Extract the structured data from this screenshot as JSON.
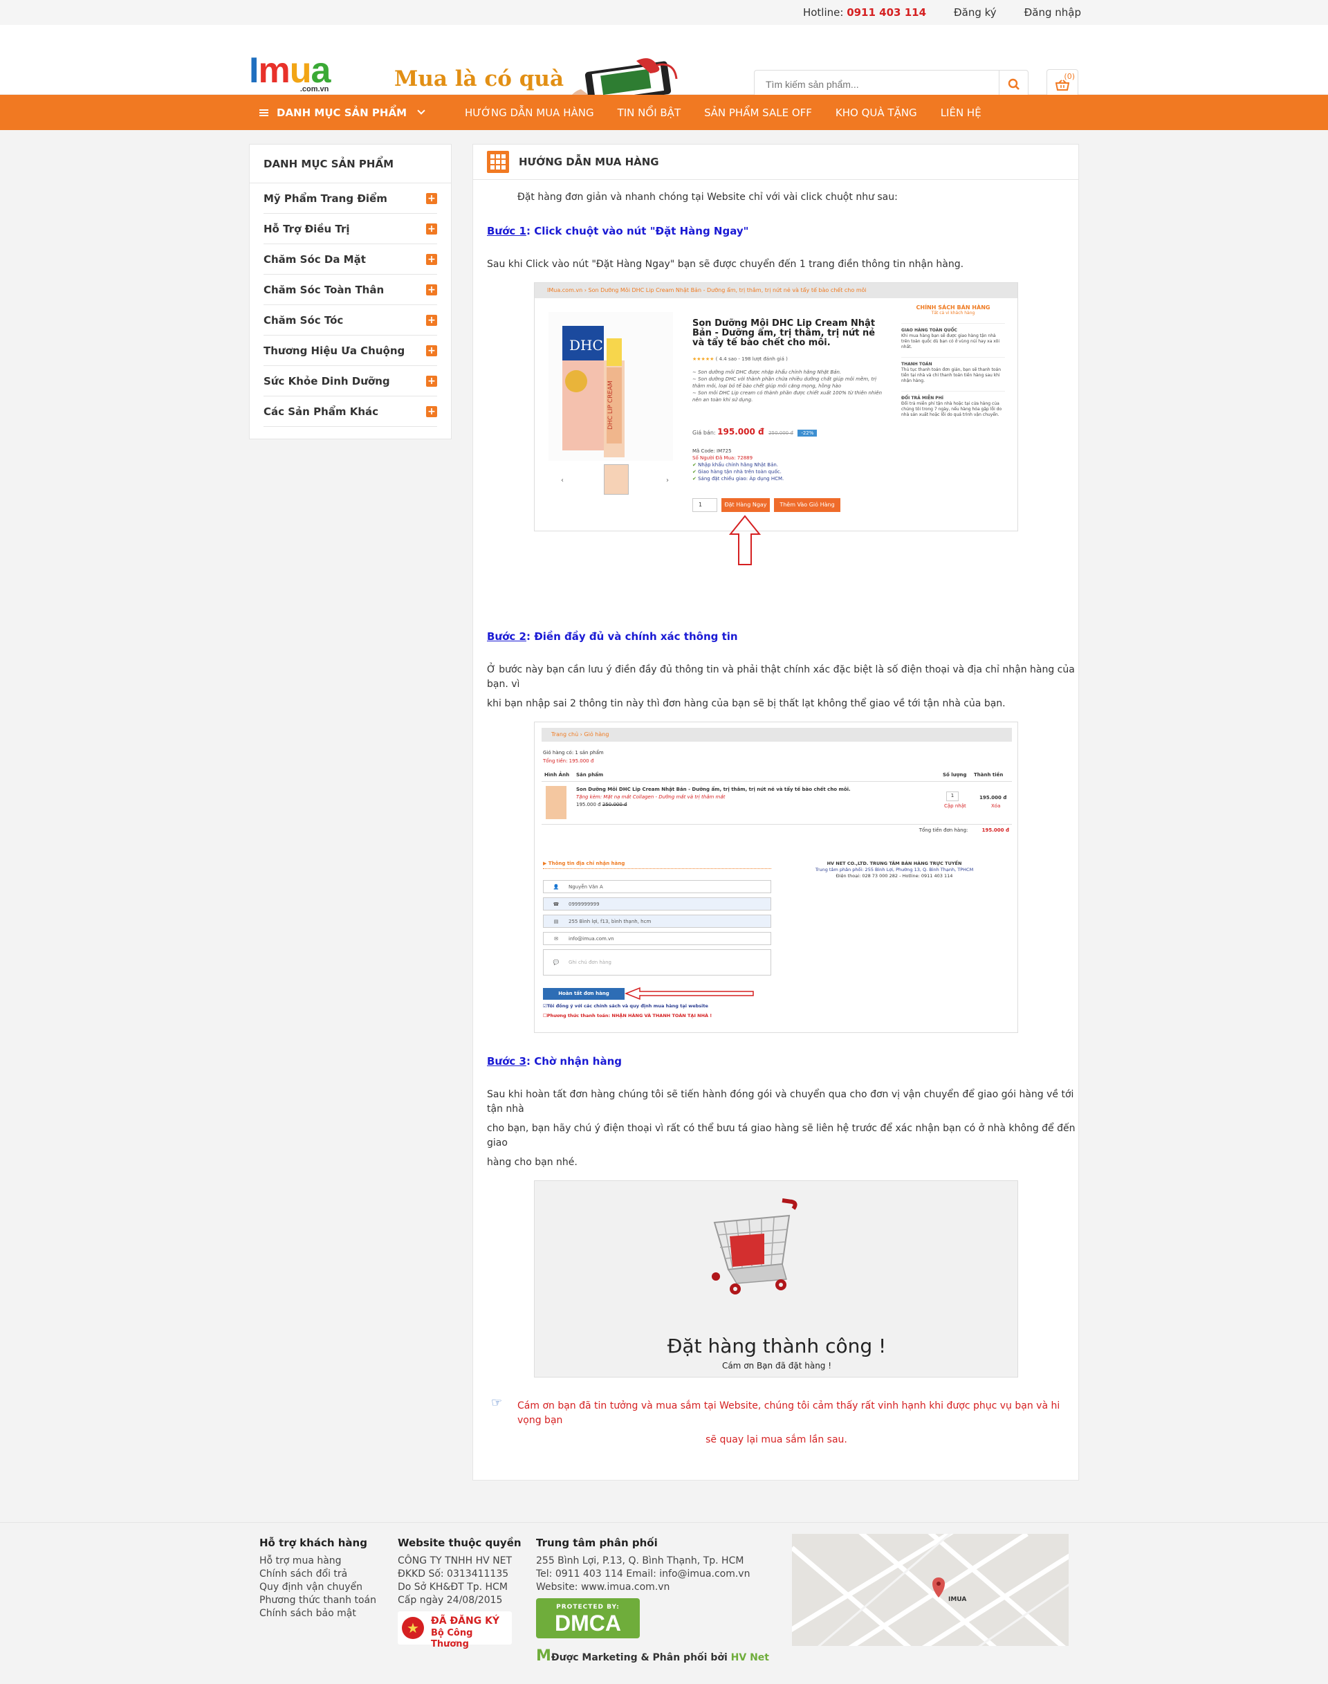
{
  "topbar": {
    "hotline_label": "Hotline:",
    "hotline_number": "0911 403 114",
    "register": "Đăng ký",
    "login": "Đăng nhập"
  },
  "header": {
    "logo": "IMUA",
    "logo_sub": ".com.vn",
    "banner_text": "Mua là có quà",
    "search_placeholder": "Tìm kiếm sản phẩm...",
    "cart_count": "(0)"
  },
  "nav": {
    "category_label": "DANH MỤC SẢN PHẨM",
    "items": [
      "HƯỚNG DẪN MUA HÀNG",
      "TIN NỔI BẬT",
      "SẢN PHẨM SALE OFF",
      "KHO QUÀ TẶNG",
      "LIÊN HỆ"
    ]
  },
  "sidebar": {
    "title": "DANH MỤC SẢN PHẨM",
    "items": [
      "Mỹ Phẩm Trang Điểm",
      "Hỗ Trợ Điều Trị",
      "Chăm Sóc Da Mặt",
      "Chăm Sóc Toàn Thân",
      "Chăm Sóc Tóc",
      "Thương Hiệu Ưa Chuộng",
      "Sức Khỏe Dinh Dưỡng",
      "Các Sản Phẩm Khác"
    ]
  },
  "main": {
    "title": "HƯỚNG DẪN MUA HÀNG",
    "intro": "Đặt hàng đơn giản và nhanh chóng tại Website chỉ với vài click chuột như sau:",
    "step1_label": "Bước 1",
    "step1_text": ": Click chuột vào nút \"Đặt Hàng Ngay\"",
    "step1_desc": "Sau khi Click vào nút \"Đặt Hàng Ngay\" bạn sẽ được chuyển đến 1 trang điền thông tin nhận hàng.",
    "step2_label": "Bước 2",
    "step2_text": ": Điền đầy đủ và chính xác thông tin",
    "step2_desc1": "Ở bước này bạn cần lưu ý điền đầy đủ thông tin và phải thật chính xác đặc biệt là số điện thoại và địa chỉ nhận hàng của bạn. vì",
    "step2_desc2": "khi bạn nhập sai 2 thông tin này thì đơn hàng của bạn sẽ bị thất lạt không thể giao về tới tận nhà của bạn.",
    "step3_label": "Bước 3",
    "step3_text": ": Chờ nhận hàng",
    "step3_desc1": "Sau khi hoàn tất đơn hàng chúng tôi sẽ tiến hành đóng gói và chuyển qua cho đơn vị vận chuyển để giao gói hàng về tới tận nhà",
    "step3_desc2": "cho bạn, bạn hãy chú ý điện thoại vì rất có thể bưu tá giao hàng sẽ liên hệ trước để xác nhận bạn có ở nhà không để đến giao",
    "step3_desc3": "hàng cho bạn nhé.",
    "thanks1": "Cám ơn bạn đã tin tưởng và mua sắm tại Website, chúng tôi cảm thấy rất vinh hạnh khi được phục vụ bạn và hi vọng bạn",
    "thanks2": "sẽ quay lại mua sắm lần sau."
  },
  "shot1": {
    "breadcrumb": "IMua.com.vn  ›  Son Dưỡng Môi DHC Lip Cream Nhật Bản - Dưỡng ẩm, trị thâm, trị nứt nẻ và tẩy tế bào chết cho môi",
    "product_title": "Son Dưỡng Môi DHC Lip Cream Nhật Bản - Dưỡng ẩm, trị thâm, trị nứt nẻ và tẩy tế bào chết cho môi.",
    "rating": "( 4.4 sao - 198 lượt đánh giá )",
    "desc1": "∼ Son dưỡng môi DHC được nhập khẩu chính hãng Nhật Bản.",
    "desc2": "∼ Son dưỡng DHC với thành phần chứa nhiều dưỡng chất giúp môi mềm, trị thâm môi, loại bỏ tế bào chết giúp môi căng mọng, hồng hào",
    "desc3": "∼ Son môi DHC Lip cream có thành phần được chiết xuất 100% từ thiên nhiên nên an toàn khi sử dụng.",
    "price_label": "Giá bán:",
    "price": "195.000 đ",
    "old_price": "250.000 đ",
    "discount": "-22%",
    "code": "Mã Code: IM725",
    "buyers": "Số Người Đã Mua: 72889",
    "check1": "Nhập khẩu chính hãng Nhật Bản.",
    "check2": "Giao hàng tận nhà trên toàn quốc.",
    "check3": "Sáng đặt chiều giao: Áp dụng HCM.",
    "qty": "1",
    "buy_now": "Đặt Hàng Ngay",
    "add_cart": "Thêm Vào Giỏ Hàng",
    "policy_title": "CHÍNH SÁCH BÁN HÀNG",
    "policy_sub": "Tất cả vì khách hàng",
    "p1_title": "GIAO HÀNG TOÀN QUỐC",
    "p1_text": "Khi mua hàng bạn sẽ được giao hàng tận nhà trên toàn quốc dù bạn có ở vùng núi hay xa xôi nhất.",
    "p2_title": "THANH TOÁN",
    "p2_text": "Thủ tục thanh toán đơn giản, bạn sẽ thanh toán tiền tại nhà và chỉ thanh toán tiền hàng sau khi nhận hàng.",
    "p3_title": "ĐỔI TRẢ MIỄN PHÍ",
    "p3_text": "Đổi trả miễn phí tận nhà hoặc tại cửa hàng của chúng tôi trong 7 ngày, nếu hàng hóa gặp lỗi do nhà sản xuất hoặc lỗi do quá trình vận chuyển."
  },
  "shot2": {
    "breadcrumb": "Trang chủ  ›  Giỏ hàng",
    "cart_count": "Giỏ hàng có: 1 sản phẩm",
    "total_label": "Tổng tiền: 195.000 đ",
    "col_img": "Hình Ảnh",
    "col_prod": "Sản phẩm",
    "col_qty": "Số lượng",
    "col_total": "Thành tiền",
    "prod_name": "Son Dưỡng Môi DHC Lip Cream Nhật Bản - Dưỡng ẩm, trị thâm, trị nứt nẻ và tẩy tế bào chết cho môi.",
    "gift": "Tặng kèm: Mặt nạ mắt Collagen - Dưỡng mắt và trị thâm mắt",
    "unit_price": "195.000 đ",
    "unit_old": "250.000 đ",
    "qty": "1",
    "update": "Cập nhật",
    "line_total": "195.000 đ",
    "remove": "Xóa",
    "order_total_label": "Tổng tiền đơn hàng:",
    "order_total": "195.000 đ",
    "ship_title": "▶ Thông tin địa chỉ nhận hàng",
    "f_name": "Nguyễn Văn A",
    "f_phone": "0999999999",
    "f_addr": "255 Bình lợi, f13, bình thạnh, hcm",
    "f_email": "info@imua.com.vn",
    "f_note": "Ghi chú đơn hàng",
    "submit": "Hoàn tất đơn hàng",
    "agree": "Tôi đồng ý với các chính sách và quy định mua hàng tại website",
    "payment": "Phương thức thanh toán: NHẬN HÀNG VÀ THANH TOÁN TẠI NHÀ !",
    "co_name": "HV NET CO.,LTD. TRUNG TÂM BÁN HÀNG TRỰC TUYẾN",
    "co_addr": "Trung tâm phân phối: 255 Bình Lợi, Phường 13, Q. Bình Thạnh, TPHCM",
    "co_phone": "Điện thoại: 028 73 000 282 - Hotline: 0911 403 114"
  },
  "shot3": {
    "title": "Đặt hàng thành công !",
    "sub": "Cám ơn Bạn đã đặt hàng !"
  },
  "footer": {
    "col1_title": "Hỗ trợ khách hàng",
    "col1_items": [
      "Hỗ trợ mua hàng",
      "Chính sách đổi trả",
      "Quy định vận chuyển",
      "Phương thức thanh toán",
      "Chính sách bảo mật"
    ],
    "col2_title": "Website thuộc quyền",
    "col2_items": [
      "CÔNG TY TNHH HV NET",
      "ĐKKD Số: 0313411135",
      "Do Sở KH&ĐT Tp. HCM",
      "Cấp ngày 24/08/2015"
    ],
    "badge_line1": "ĐÃ ĐĂNG KÝ",
    "badge_line2": "Bộ Công Thương",
    "col3_title": "Trung tâm phân phối",
    "col3_items": [
      "255 Bình Lợi, P.13, Q. Bình Thạnh, Tp. HCM",
      "Tel: 0911 403 114 Email: info@imua.com.vn",
      "Website: www.imua.com.vn"
    ],
    "dmca_top": "PROTECTED BY:",
    "dmca": "DMCA",
    "marketing": "Được Marketing & Phân phối bởi",
    "marketing_brand": "HV Net",
    "map_label": "IMUA"
  },
  "colors": {
    "accent": "#f17922",
    "step_blue": "#1a1ad4",
    "price_red": "#d52021"
  }
}
